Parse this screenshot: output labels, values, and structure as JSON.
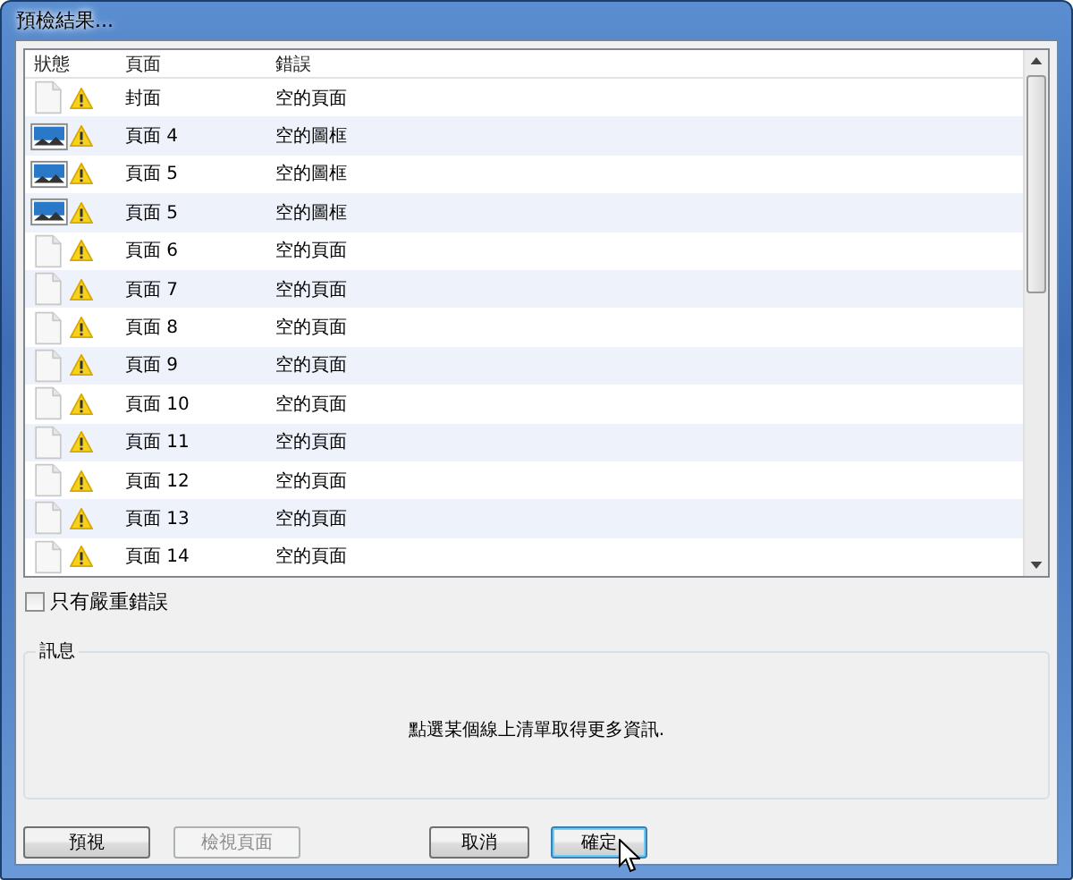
{
  "window": {
    "title": "預檢結果..."
  },
  "table": {
    "columns": [
      "狀態",
      "頁面",
      "錯誤"
    ],
    "rows": [
      {
        "kind": "page",
        "page": "封面",
        "error": "空的頁面"
      },
      {
        "kind": "frame",
        "page": "頁面 4",
        "error": "空的圖框"
      },
      {
        "kind": "frame",
        "page": "頁面 5",
        "error": "空的圖框"
      },
      {
        "kind": "frame",
        "page": "頁面 5",
        "error": "空的圖框"
      },
      {
        "kind": "page",
        "page": "頁面 6",
        "error": "空的頁面"
      },
      {
        "kind": "page",
        "page": "頁面 7",
        "error": "空的頁面"
      },
      {
        "kind": "page",
        "page": "頁面 8",
        "error": "空的頁面"
      },
      {
        "kind": "page",
        "page": "頁面 9",
        "error": "空的頁面"
      },
      {
        "kind": "page",
        "page": "頁面 10",
        "error": "空的頁面"
      },
      {
        "kind": "page",
        "page": "頁面 11",
        "error": "空的頁面"
      },
      {
        "kind": "page",
        "page": "頁面 12",
        "error": "空的頁面"
      },
      {
        "kind": "page",
        "page": "頁面 13",
        "error": "空的頁面"
      },
      {
        "kind": "page",
        "page": "頁面 14",
        "error": "空的頁面"
      }
    ]
  },
  "severe_only": {
    "label": "只有嚴重錯誤",
    "checked": false
  },
  "info": {
    "title": "訊息",
    "message": "點選某個線上清單取得更多資訊."
  },
  "buttons": [
    {
      "label": "預視",
      "disabled": false,
      "focused": false
    },
    {
      "label": "檢視頁面",
      "disabled": true,
      "focused": false
    },
    {
      "label": "取消",
      "disabled": false,
      "focused": false
    },
    {
      "label": "確定",
      "disabled": false,
      "focused": true
    }
  ]
}
